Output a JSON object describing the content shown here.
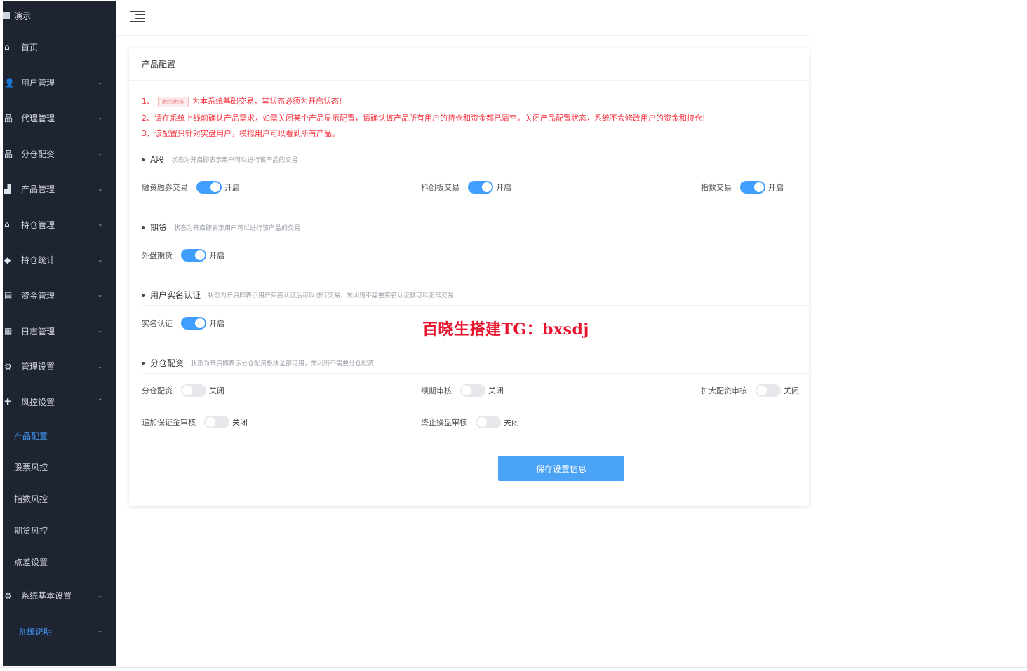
{
  "sidebar": {
    "brand": "演示",
    "items": [
      {
        "label": "首页",
        "icon": "home-icon",
        "glyph": "⌂",
        "chev": ""
      },
      {
        "label": "用户管理",
        "icon": "user-icon",
        "glyph": "👤",
        "chev": "⌄"
      },
      {
        "label": "代理管理",
        "icon": "org-icon",
        "glyph": "品",
        "chev": "⌄"
      },
      {
        "label": "分仓配资",
        "icon": "org-icon",
        "glyph": "品",
        "chev": "⌄"
      },
      {
        "label": "产品管理",
        "icon": "chart-icon",
        "glyph": "▟",
        "chev": "⌄"
      },
      {
        "label": "持仓管理",
        "icon": "house-icon",
        "glyph": "⌂",
        "chev": "⌄"
      },
      {
        "label": "持仓统计",
        "icon": "graduation-icon",
        "glyph": "◆",
        "chev": "⌄"
      },
      {
        "label": "资金管理",
        "icon": "wallet-icon",
        "glyph": "▤",
        "chev": "⌄"
      },
      {
        "label": "日志管理",
        "icon": "log-icon",
        "glyph": "▦",
        "chev": "⌄"
      },
      {
        "label": "管理设置",
        "icon": "settings-icon",
        "glyph": "⚙",
        "chev": "⌄"
      },
      {
        "label": "风控设置",
        "icon": "shield-icon",
        "glyph": "✚",
        "chev": "⌃"
      }
    ],
    "sub_items": [
      {
        "label": "产品配置",
        "active": true
      },
      {
        "label": "股票风控"
      },
      {
        "label": "指数风控"
      },
      {
        "label": "期货风控"
      },
      {
        "label": "点差设置"
      }
    ],
    "bottom_items": [
      {
        "label": "系统基本设置",
        "icon": "gear-icon",
        "glyph": "⚙",
        "chev": "⌄"
      },
      {
        "label": "系统说明",
        "icon": "",
        "glyph": "",
        "chev": "⌄"
      }
    ]
  },
  "card": {
    "title": "产品配置",
    "notice": {
      "l1_prefix": "1、",
      "l1_tag": "融资融券",
      "l1_rest": "为本系统基础交易，其状态必须为开启状态!",
      "l2": "2、请在系统上线前确认产品需求，如需关闭某个产品显示配置，请确认该产品所有用户的持仓和资金都已清空。关闭产品配置状态，系统不会修改用户的资金和持仓!",
      "l3": "3、该配置只针对实盘用户，模拟用户可以看到所有产品。"
    },
    "sections": {
      "a": {
        "title": "A股",
        "desc": "状态为开启即表示用户可以进行该产品的交易"
      },
      "futures": {
        "title": "期货",
        "desc": "状态为开启即表示用户可以进行该产品的交易"
      },
      "realname": {
        "title": "用户实名认证",
        "desc": "状态为开启即表示用户实名认证后可以进行交易，关闭则不需要实名认证就可以正常交易"
      },
      "split": {
        "title": "分仓配资",
        "desc": "状态为开启即表示分仓配资板块全部可用，关闭则不需要分仓配资"
      }
    },
    "fields": {
      "margin": {
        "label": "融资融券交易",
        "status": "开启"
      },
      "star": {
        "label": "科创板交易",
        "status": "开启"
      },
      "index": {
        "label": "指数交易",
        "status": "开启"
      },
      "foreign_futures": {
        "label": "外盘期货",
        "status": "开启"
      },
      "realname": {
        "label": "实名认证",
        "status": "开启"
      },
      "split": {
        "label": "分仓配资",
        "status": "关闭"
      },
      "renew": {
        "label": "续期审核",
        "status": "关闭"
      },
      "expand": {
        "label": "扩大配资审核",
        "status": "关闭"
      },
      "margin_add": {
        "label": "追加保证金审核",
        "status": "关闭"
      },
      "terminate": {
        "label": "终止操盘审核",
        "status": "关闭"
      }
    },
    "save_label": "保存设置信息"
  },
  "watermark": "百晓生搭建TG：bxsdj",
  "colors": {
    "sidebar_bg": "#1f2433",
    "accent": "#409eff",
    "notice": "#f5333f",
    "switch_off": "#e6e8eb"
  }
}
